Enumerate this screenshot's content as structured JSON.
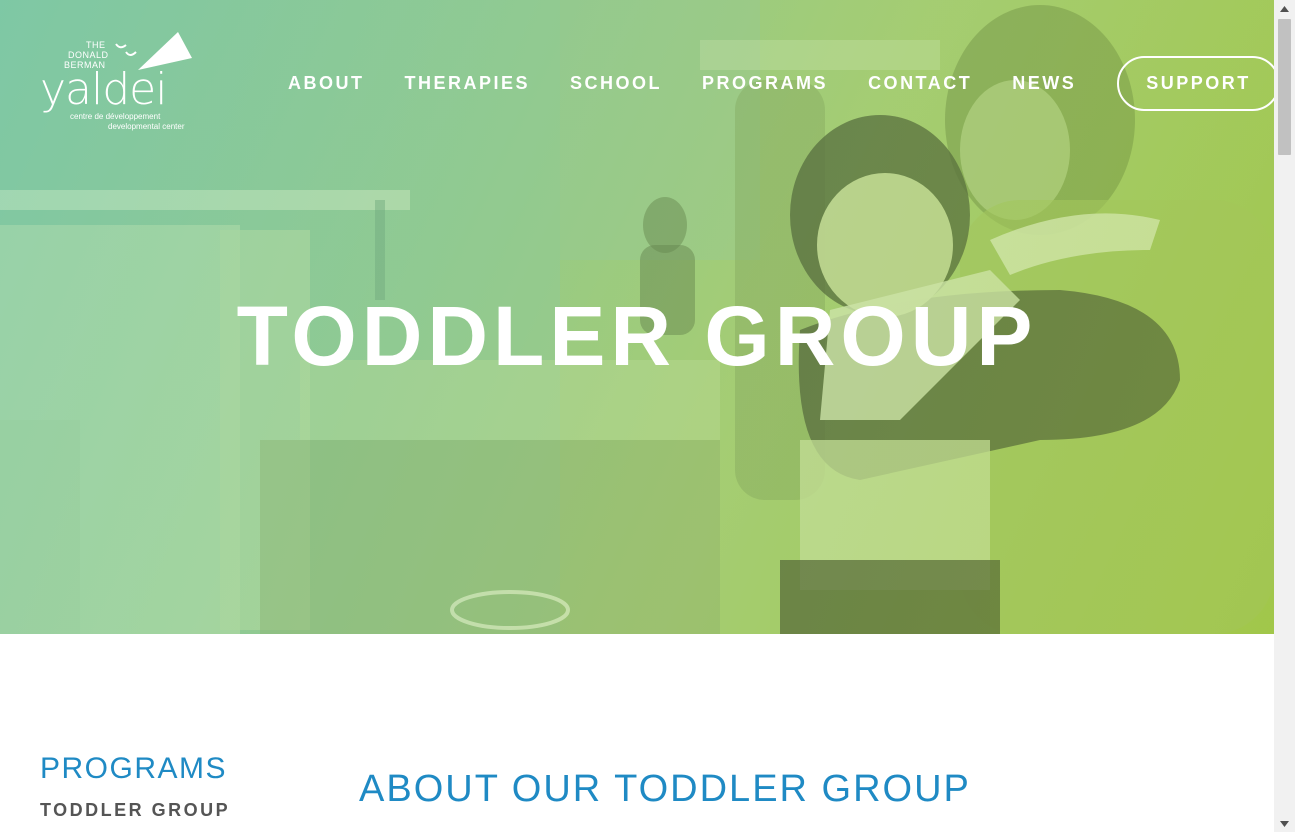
{
  "logo": {
    "line1": "THE",
    "line2": "DONALD",
    "line3": "BERMAN",
    "wordmark": "yaldei",
    "sub_fr": "centre de développement",
    "sub_en": "developmental center",
    "icon": "bird-kite-icon"
  },
  "nav": {
    "items": [
      {
        "label": "ABOUT"
      },
      {
        "label": "THERAPIES"
      },
      {
        "label": "SCHOOL"
      },
      {
        "label": "PROGRAMS"
      },
      {
        "label": "CONTACT"
      },
      {
        "label": "NEWS"
      }
    ],
    "support_label": "SUPPORT"
  },
  "hero": {
    "title": "TODDLER GROUP",
    "photo": "child-hugging-teacher-classroom-image",
    "colors": {
      "overlay_start": "#7fc7a4",
      "overlay_end": "#9fc64c"
    }
  },
  "sidebar": {
    "title": "PROGRAMS",
    "items": [
      {
        "label": "TODDLER GROUP"
      }
    ]
  },
  "main": {
    "section_title": "ABOUT OUR TODDLER GROUP"
  },
  "colors": {
    "accent": "#1f8ac4",
    "sidebar_text": "#555555",
    "nav_text": "#ffffff"
  }
}
